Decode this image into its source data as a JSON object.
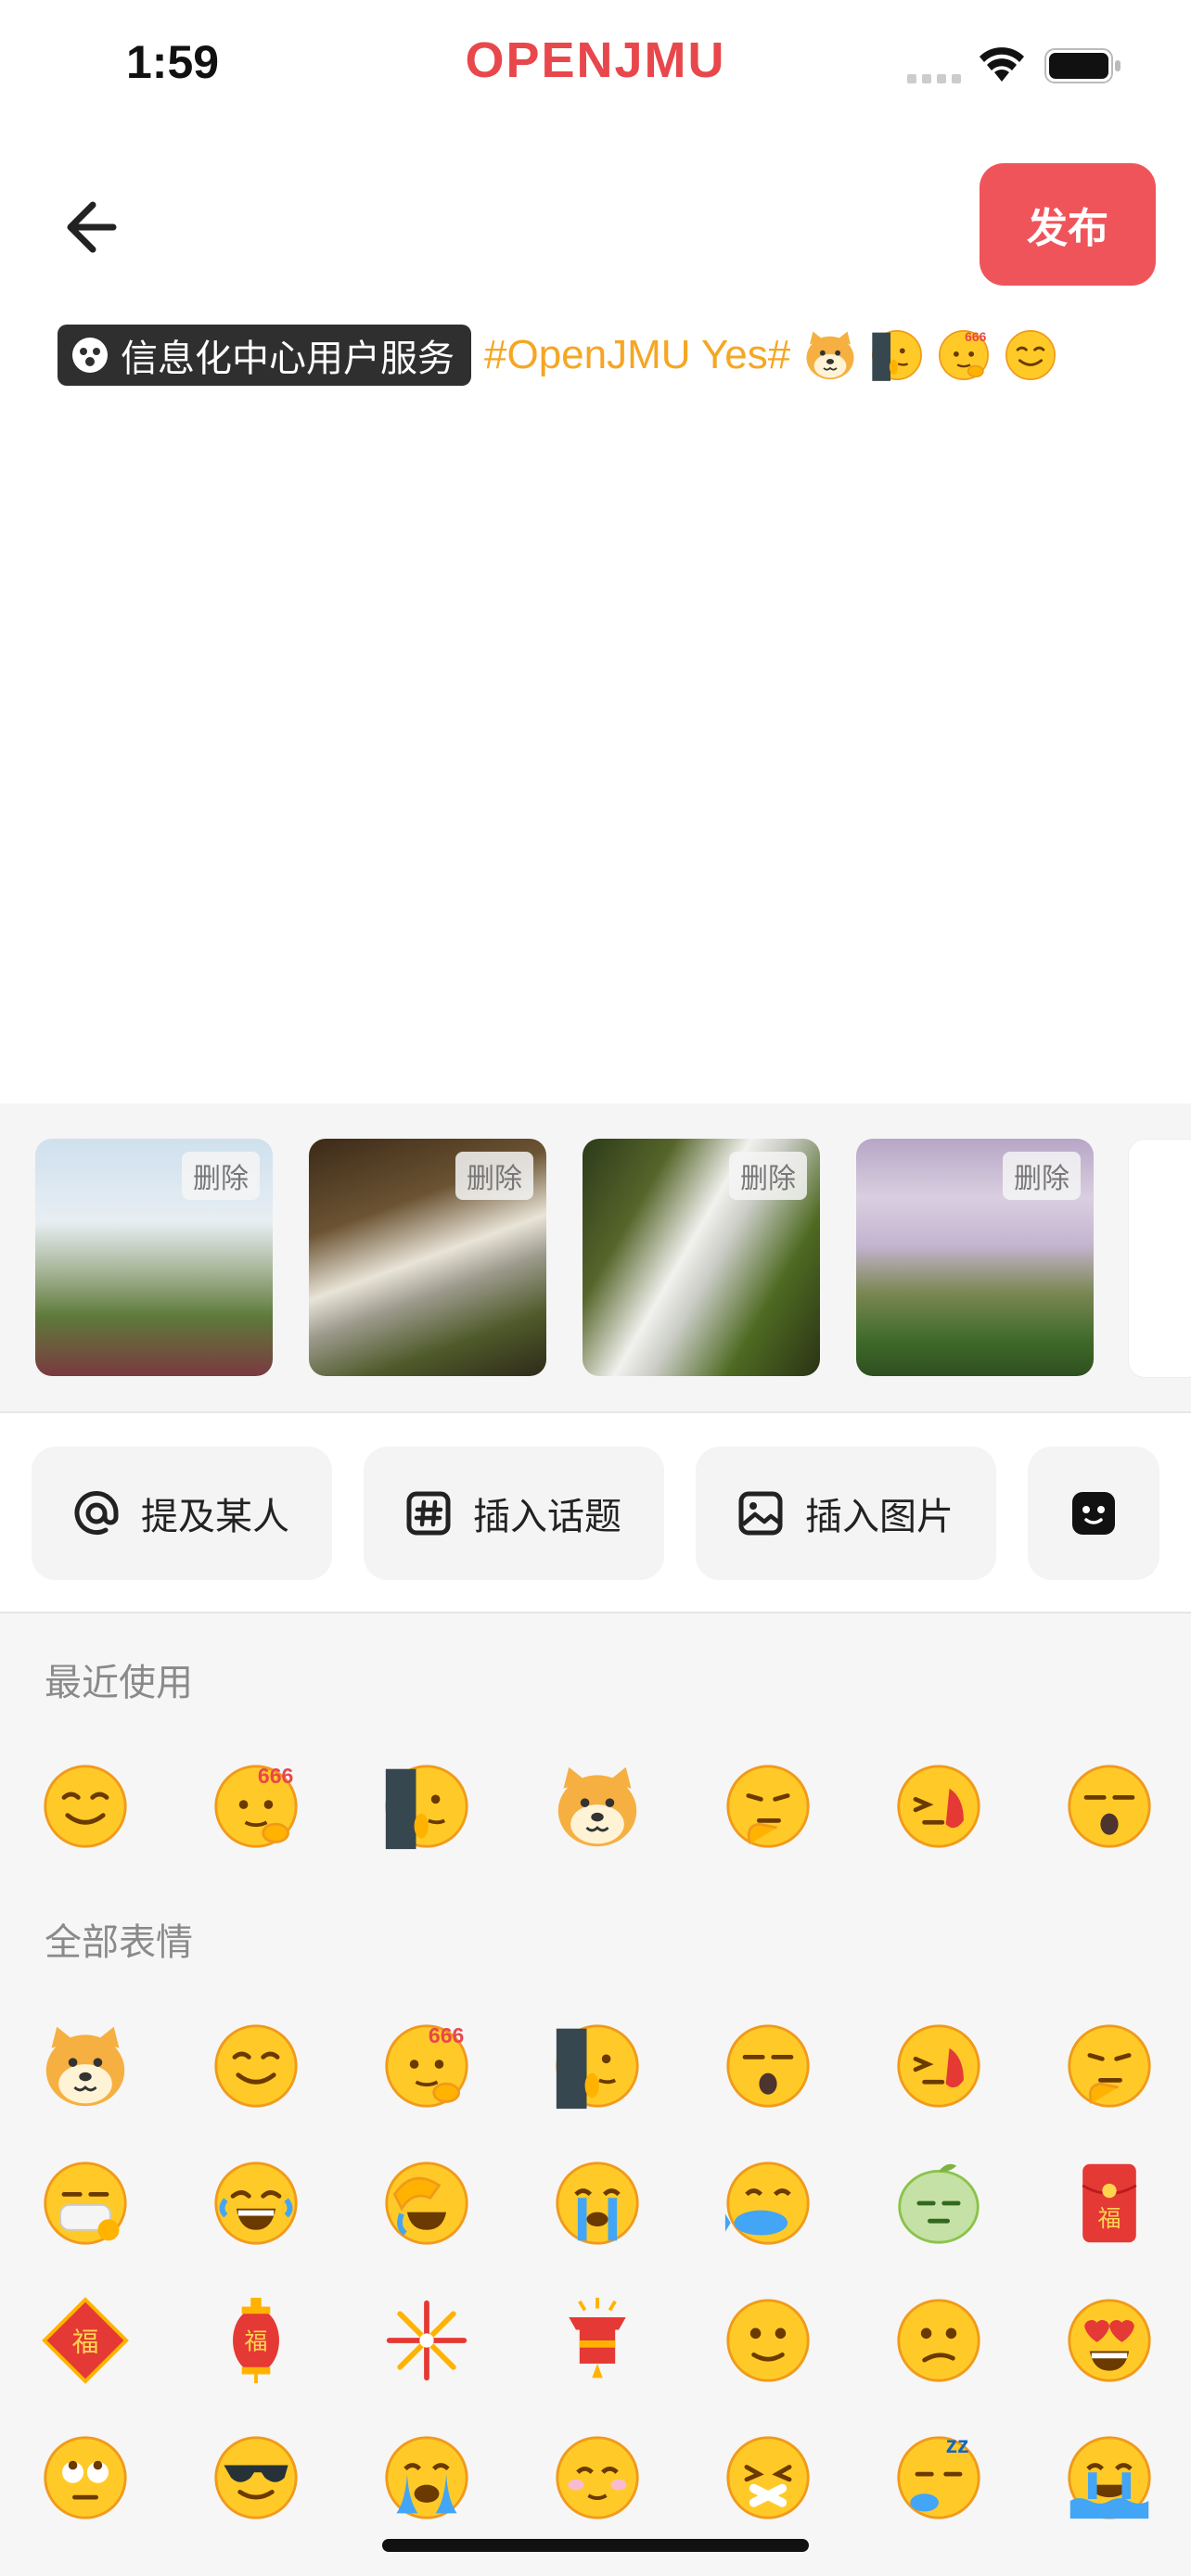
{
  "status_bar": {
    "time": "1:59",
    "app_name": "OPENJMU",
    "wifi_icon": "wifi-icon",
    "battery_icon": "battery-icon"
  },
  "header": {
    "back_icon": "arrow-left-icon",
    "publish_label": "发布"
  },
  "editor": {
    "mention_text": "信息化中心用户服务",
    "topic_text": "#OpenJMU Yes#",
    "inline_emojis": [
      "doge",
      "peek",
      "666",
      "smile"
    ]
  },
  "images": {
    "delete_label": "删除",
    "count_visible": 4
  },
  "toolbar": {
    "mention_label": "提及某人",
    "topic_label": "插入话题",
    "image_label": "插入图片",
    "emoji_icon": "emoji-face-icon"
  },
  "emoji_panel": {
    "recent_title": "最近使用",
    "all_title": "全部表情",
    "recent": [
      "smile",
      "666",
      "peek",
      "doge",
      "think",
      "facepalm-hand",
      "yawn"
    ],
    "all": [
      [
        "doge",
        "smile",
        "666",
        "peek",
        "yawn",
        "facepalm-hand",
        "think"
      ],
      [
        "mask",
        "laugh-cry",
        "facepalm",
        "cry",
        "fish",
        "lemon",
        "red-envelope"
      ],
      [
        "fu-diamond",
        "lantern",
        "fireworks",
        "firecracker",
        "slight-smile",
        "confused",
        "heart-eyes"
      ],
      [
        "eye-roll",
        "cool",
        "sob",
        "blush",
        "shush",
        "sleepy",
        "crying-river"
      ]
    ],
    "colors": {
      "face": "#ffca28",
      "outline": "#f19a1a",
      "accent": "#e8474b"
    }
  }
}
